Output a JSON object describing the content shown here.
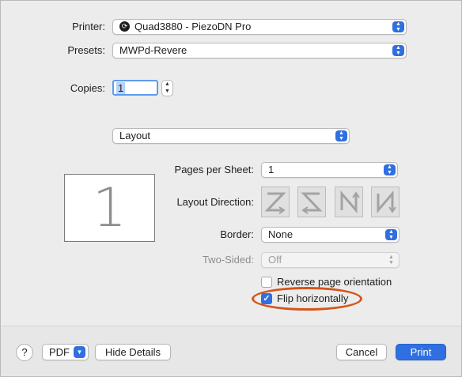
{
  "printer": {
    "label": "Printer:",
    "value": "Quad3880 - PiezoDN Pro",
    "icon": "printer-share-icon"
  },
  "presets": {
    "label": "Presets:",
    "value": "MWPd-Revere"
  },
  "copies": {
    "label": "Copies:",
    "value": "1"
  },
  "section": {
    "value": "Layout"
  },
  "preview": {
    "page_number": "1"
  },
  "layout": {
    "pages_per_sheet": {
      "label": "Pages per Sheet:",
      "value": "1"
    },
    "layout_direction": {
      "label": "Layout Direction:"
    },
    "border": {
      "label": "Border:",
      "value": "None"
    },
    "two_sided": {
      "label": "Two-Sided:",
      "value": "Off"
    },
    "reverse_orientation": {
      "label": "Reverse page orientation",
      "checked": false
    },
    "flip_horizontally": {
      "label": "Flip horizontally",
      "checked": true
    }
  },
  "footer": {
    "help": "?",
    "pdf": "PDF",
    "hide_details": "Hide Details",
    "cancel": "Cancel",
    "print": "Print"
  },
  "colors": {
    "accent": "#2f6fe0",
    "highlight_ellipse": "#d6541a"
  }
}
